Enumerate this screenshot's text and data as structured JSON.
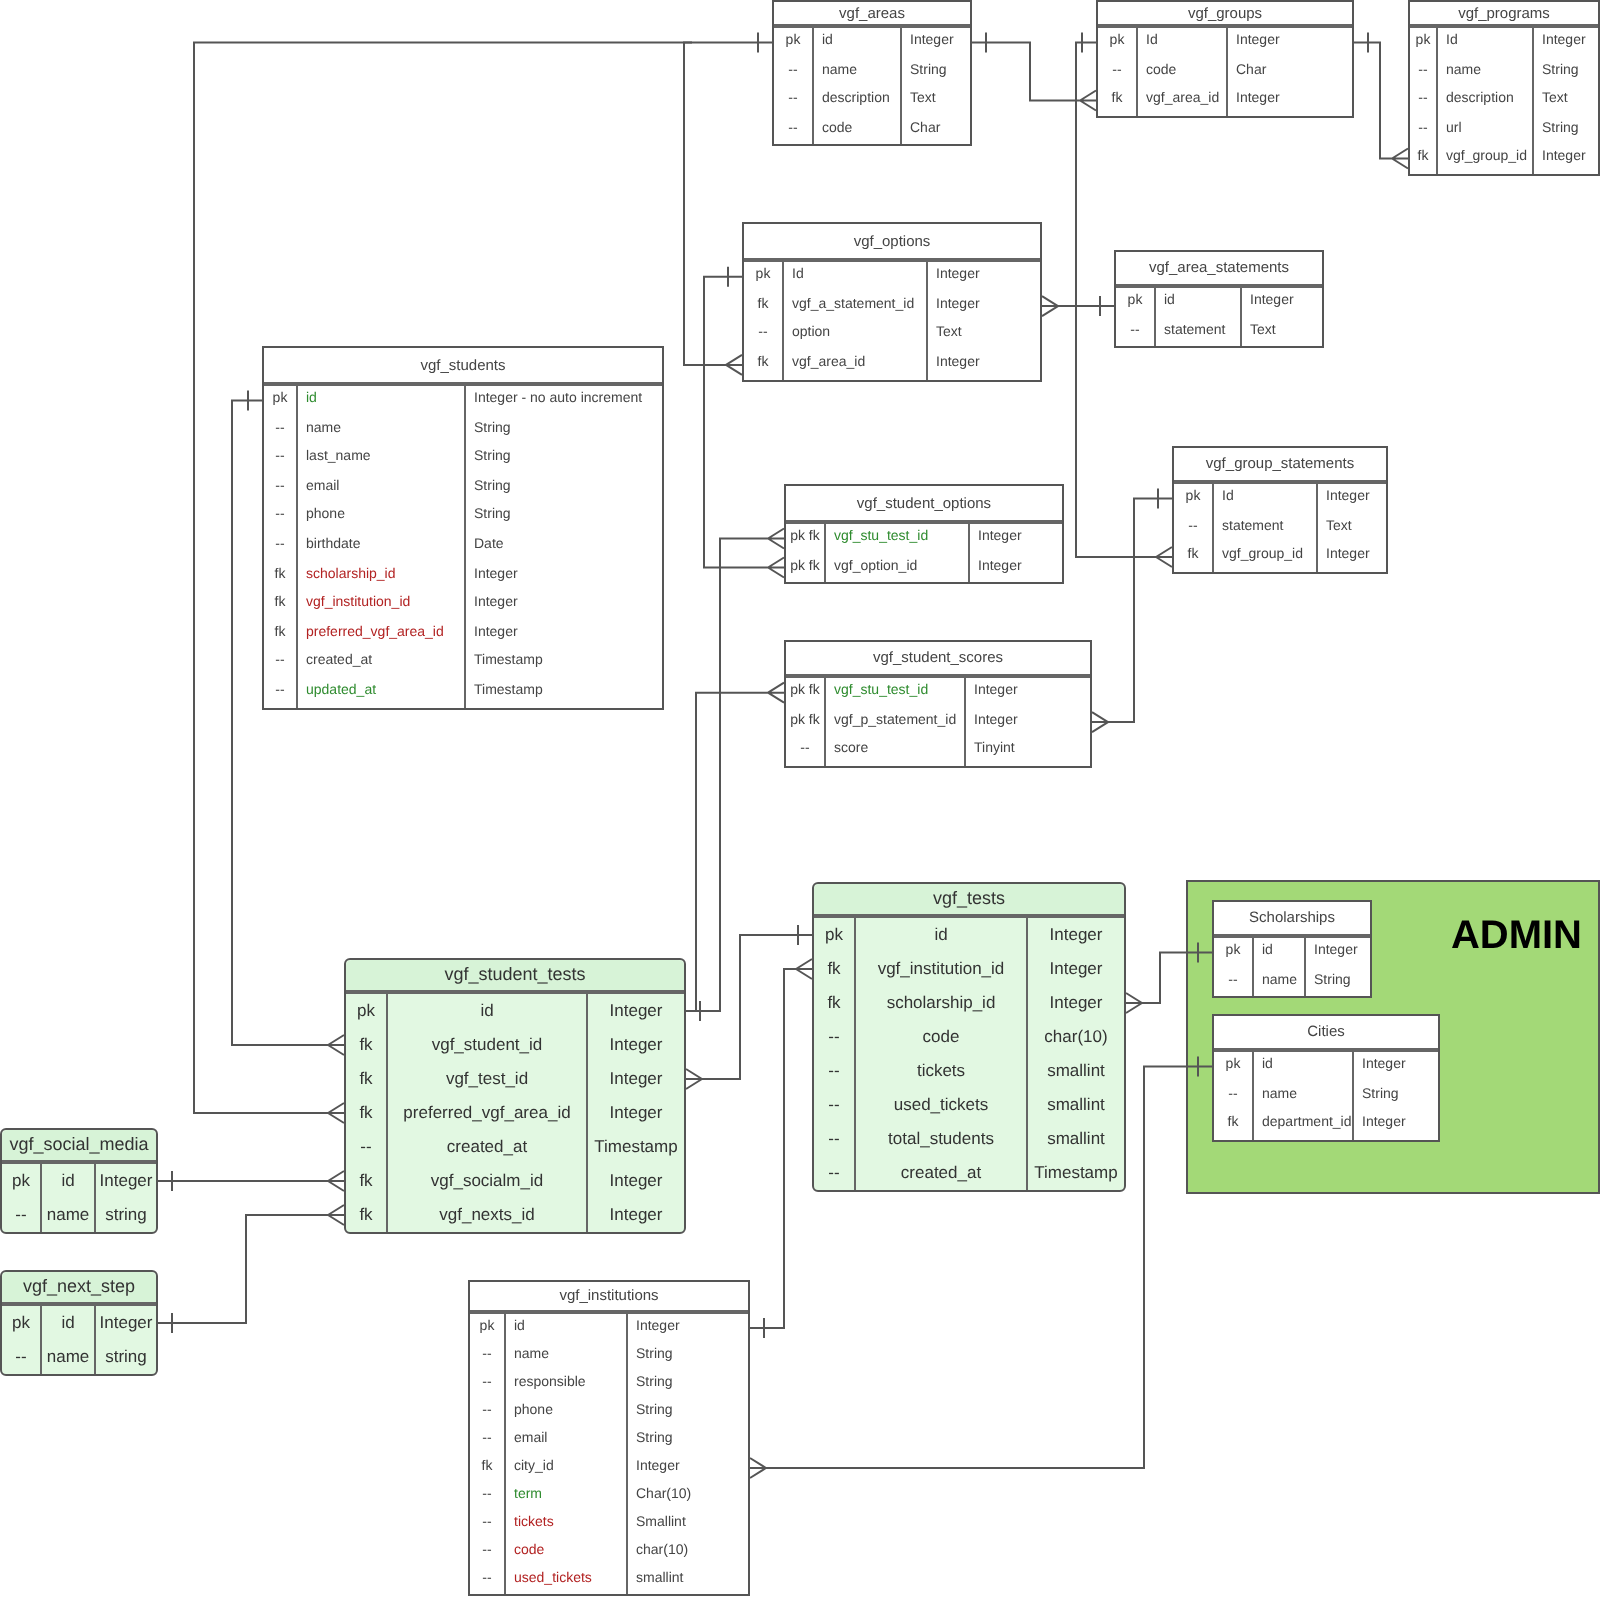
{
  "admin_area": {
    "label": "ADMIN"
  },
  "tables": [
    {
      "title": "vgf_areas",
      "kind": "plain",
      "fields": [
        {
          "key": "pk",
          "name": "id",
          "type": "Integer"
        },
        {
          "key": "--",
          "name": "name",
          "type": "String"
        },
        {
          "key": "--",
          "name": "description",
          "type": "Text"
        },
        {
          "key": "--",
          "name": "code",
          "type": "Char"
        }
      ]
    },
    {
      "title": "vgf_groups",
      "kind": "plain",
      "fields": [
        {
          "key": "pk",
          "name": "Id",
          "type": "Integer"
        },
        {
          "key": "--",
          "name": "code",
          "type": "Char"
        },
        {
          "key": "fk",
          "name": "vgf_area_id",
          "type": "Integer"
        }
      ]
    },
    {
      "title": "vgf_programs",
      "kind": "plain",
      "fields": [
        {
          "key": "pk",
          "name": "Id",
          "type": "Integer"
        },
        {
          "key": "--",
          "name": "name",
          "type": "String"
        },
        {
          "key": "--",
          "name": "description",
          "type": "Text"
        },
        {
          "key": "--",
          "name": "url",
          "type": "String"
        },
        {
          "key": "fk",
          "name": "vgf_group_id",
          "type": "Integer"
        }
      ]
    },
    {
      "title": "vgf_options",
      "kind": "plain",
      "fields": [
        {
          "key": "pk",
          "name": "Id",
          "type": "Integer"
        },
        {
          "key": "fk",
          "name": "vgf_a_statement_id",
          "type": "Integer"
        },
        {
          "key": "--",
          "name": "option",
          "type": "Text"
        },
        {
          "key": "fk",
          "name": "vgf_area_id",
          "type": "Integer"
        }
      ]
    },
    {
      "title": "vgf_area_statements",
      "kind": "plain",
      "fields": [
        {
          "key": "pk",
          "name": "id",
          "type": "Integer"
        },
        {
          "key": "--",
          "name": "statement",
          "type": "Text"
        }
      ]
    },
    {
      "title": "vgf_students",
      "kind": "plain",
      "fields": [
        {
          "key": "pk",
          "name": "id",
          "type": "Integer - no auto increment",
          "color": "#2e8b2e"
        },
        {
          "key": "--",
          "name": "name",
          "type": "String"
        },
        {
          "key": "--",
          "name": "last_name",
          "type": "String"
        },
        {
          "key": "--",
          "name": "email",
          "type": "String"
        },
        {
          "key": "--",
          "name": "phone",
          "type": "String"
        },
        {
          "key": "--",
          "name": "birthdate",
          "type": "Date"
        },
        {
          "key": "fk",
          "name": "scholarship_id",
          "type": "Integer",
          "color": "#b22222"
        },
        {
          "key": "fk",
          "name": "vgf_institution_id",
          "type": "Integer",
          "color": "#b22222"
        },
        {
          "key": "fk",
          "name": "preferred_vgf_area_id",
          "type": "Integer",
          "color": "#b22222"
        },
        {
          "key": "--",
          "name": "created_at",
          "type": "Timestamp"
        },
        {
          "key": "--",
          "name": "updated_at",
          "type": "Timestamp",
          "color": "#2e8b2e"
        }
      ]
    },
    {
      "title": "vgf_group_statements",
      "kind": "plain",
      "fields": [
        {
          "key": "pk",
          "name": "Id",
          "type": "Integer"
        },
        {
          "key": "--",
          "name": "statement",
          "type": "Text"
        },
        {
          "key": "fk",
          "name": "vgf_group_id",
          "type": "Integer"
        }
      ]
    },
    {
      "title": "vgf_student_options",
      "kind": "plain",
      "fields": [
        {
          "key": "pk fk",
          "name": "vgf_stu_test_id",
          "type": "Integer",
          "color": "#2e8b2e"
        },
        {
          "key": "pk fk",
          "name": "vgf_option_id",
          "type": "Integer"
        }
      ]
    },
    {
      "title": "vgf_student_scores",
      "kind": "plain",
      "fields": [
        {
          "key": "pk fk",
          "name": "vgf_stu_test_id",
          "type": "Integer",
          "color": "#2e8b2e"
        },
        {
          "key": "pk fk",
          "name": "vgf_p_statement_id",
          "type": "Integer"
        },
        {
          "key": "--",
          "name": "score",
          "type": "Tinyint"
        }
      ]
    },
    {
      "title": "vgf_tests",
      "kind": "highlighted",
      "fields": [
        {
          "key": "pk",
          "name": "id",
          "type": "Integer"
        },
        {
          "key": "fk",
          "name": "vgf_institution_id",
          "type": "Integer"
        },
        {
          "key": "fk",
          "name": "scholarship_id",
          "type": "Integer"
        },
        {
          "key": "--",
          "name": "code",
          "type": "char(10)"
        },
        {
          "key": "--",
          "name": "tickets",
          "type": "smallint"
        },
        {
          "key": "--",
          "name": "used_tickets",
          "type": "smallint"
        },
        {
          "key": "--",
          "name": "total_students",
          "type": "smallint"
        },
        {
          "key": "--",
          "name": "created_at",
          "type": "Timestamp"
        }
      ]
    },
    {
      "title": "Scholarships",
      "kind": "plain",
      "fields": [
        {
          "key": "pk",
          "name": "id",
          "type": "Integer"
        },
        {
          "key": "--",
          "name": "name",
          "type": "String"
        }
      ]
    },
    {
      "title": "Cities",
      "kind": "plain",
      "fields": [
        {
          "key": "pk",
          "name": "id",
          "type": "Integer"
        },
        {
          "key": "--",
          "name": "name",
          "type": "String"
        },
        {
          "key": "fk",
          "name": "department_id",
          "type": "Integer"
        }
      ]
    },
    {
      "title": "vgf_social_media",
      "kind": "highlighted",
      "fields": [
        {
          "key": "pk",
          "name": "id",
          "type": "Integer"
        },
        {
          "key": "--",
          "name": "name",
          "type": "string"
        }
      ]
    },
    {
      "title": "vgf_next_step",
      "kind": "highlighted",
      "fields": [
        {
          "key": "pk",
          "name": "id",
          "type": "Integer"
        },
        {
          "key": "--",
          "name": "name",
          "type": "string"
        }
      ]
    },
    {
      "title": "vgf_student_tests",
      "kind": "highlighted",
      "fields": [
        {
          "key": "pk",
          "name": "id",
          "type": "Integer"
        },
        {
          "key": "fk",
          "name": "vgf_student_id",
          "type": "Integer"
        },
        {
          "key": "fk",
          "name": "vgf_test_id",
          "type": "Integer"
        },
        {
          "key": "fk",
          "name": "preferred_vgf_area_id",
          "type": "Integer"
        },
        {
          "key": "--",
          "name": "created_at",
          "type": "Timestamp"
        },
        {
          "key": "fk",
          "name": "vgf_socialm_id",
          "type": "Integer"
        },
        {
          "key": "fk",
          "name": "vgf_nexts_id",
          "type": "Integer"
        }
      ]
    },
    {
      "title": "vgf_institutions",
      "kind": "plain",
      "fields": [
        {
          "key": "pk",
          "name": "id",
          "type": "Integer"
        },
        {
          "key": "--",
          "name": "name",
          "type": "String"
        },
        {
          "key": "--",
          "name": "responsible",
          "type": "String"
        },
        {
          "key": "--",
          "name": "phone",
          "type": "String"
        },
        {
          "key": "--",
          "name": "email",
          "type": "String"
        },
        {
          "key": "fk",
          "name": "city_id",
          "type": "Integer"
        },
        {
          "key": "--",
          "name": "term",
          "type": "Char(10)",
          "color": "#2e8b2e"
        },
        {
          "key": "--",
          "name": "tickets",
          "type": "Smallint",
          "color": "#b22222"
        },
        {
          "key": "--",
          "name": "code",
          "type": "char(10)",
          "color": "#b22222"
        },
        {
          "key": "--",
          "name": "used_tickets",
          "type": "smallint",
          "color": "#b22222"
        }
      ]
    }
  ]
}
